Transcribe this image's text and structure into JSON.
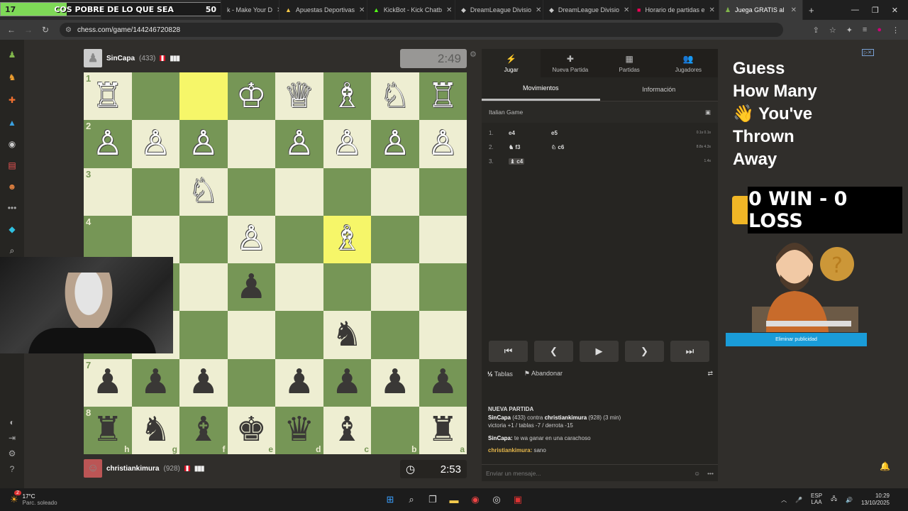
{
  "browser": {
    "overlay": {
      "num": "17",
      "text": "COS POBRE DE LO QUE SEA",
      "num2": "50"
    },
    "tabs": [
      {
        "label": "k - Make Your D"
      },
      {
        "label": "Apuestas Deportivas"
      },
      {
        "label": "KickBot - Kick Chatb"
      },
      {
        "label": "DreamLeague Divisio"
      },
      {
        "label": "DreamLeague Divisio"
      },
      {
        "label": "Horario de partidas e"
      },
      {
        "label": "Juega GRATIS al"
      }
    ],
    "new_tab": "+",
    "url": "chess.com/game/144246720828"
  },
  "players": {
    "top": {
      "name": "SinCapa",
      "rating": "(433)",
      "bars": "▮▮▮",
      "clock": "2:49"
    },
    "bottom": {
      "name": "christiankimura",
      "rating": "(928)",
      "bars": "▮▮▮",
      "clock": "2:53"
    }
  },
  "board": {
    "ranks": [
      "1",
      "2",
      "3",
      "4",
      "5",
      "6",
      "7",
      "8"
    ],
    "files": [
      "h",
      "g",
      "f",
      "e",
      "d",
      "c",
      "b",
      "a"
    ],
    "rows": [
      [
        "♖",
        "",
        "",
        "♔",
        "♕",
        "♗",
        "♘",
        "♖"
      ],
      [
        "♙",
        "♙",
        "♙",
        "",
        "♙",
        "♙",
        "♙",
        "♙"
      ],
      [
        "",
        "",
        "♘",
        "",
        "",
        "",
        "",
        ""
      ],
      [
        "",
        "",
        "",
        "♙",
        "",
        "♗",
        "",
        ""
      ],
      [
        "",
        "",
        "",
        "♟",
        "",
        "",
        "",
        ""
      ],
      [
        "",
        "",
        "",
        "",
        "",
        "♞",
        "",
        ""
      ],
      [
        "♟",
        "♟",
        "♟",
        "",
        "♟",
        "♟",
        "♟",
        "♟"
      ],
      [
        "♜",
        "♞",
        "♝",
        "♚",
        "♛",
        "♝",
        "",
        "♜"
      ]
    ]
  },
  "panel": {
    "tabs": [
      {
        "label": "Jugar",
        "icon": "⚡"
      },
      {
        "label": "Nueva Partida",
        "icon": "✚"
      },
      {
        "label": "Partidas",
        "icon": "▦"
      },
      {
        "label": "Jugadores",
        "icon": "👥"
      }
    ],
    "subtabs": [
      "Movimientos",
      "Información"
    ],
    "opening": "Italian Game",
    "moves": [
      {
        "n": "1.",
        "w": "e4",
        "b": "e5",
        "t": "0.1s 0.1s"
      },
      {
        "n": "2.",
        "w": "♞ f3",
        "b": "♘ c6",
        "t": "8.8s 4.3s"
      },
      {
        "n": "3.",
        "w": "♝ c4",
        "b": "",
        "t": "1.4s"
      }
    ],
    "controls": [
      "⏮",
      "❮",
      "▶",
      "❯",
      "⏭"
    ],
    "draw": "Tablas",
    "resign": "Abandonar",
    "chat": {
      "header": "NUEVA PARTIDA",
      "line1_a": "SinCapa",
      "line1_b": " (433) contra ",
      "line1_c": "christiankimura",
      "line1_d": " (928) (3 min)",
      "line2": "victoria +1 / tablas -7 / derrota -15",
      "msg1_name": "SinCapa:",
      "msg1_text": " te wa ganar en una carachoso",
      "msg2_name": "christiankimura:",
      "msg2_text": " sano"
    },
    "message_placeholder": "Enviar un mensaje..."
  },
  "ad": {
    "headline": [
      "Guess",
      "How Many",
      "👋 You've",
      "Thrown",
      "Away"
    ],
    "overlay_score": "0 WIN - 0 LOSS",
    "button": "Eliminar publicidad"
  },
  "taskbar": {
    "temp": "17°C",
    "condition": "Parc. soleado",
    "lang1": "ESP",
    "lang2": "LAA",
    "time": "10:29",
    "date": "13/10/2025",
    "badge": "2"
  }
}
